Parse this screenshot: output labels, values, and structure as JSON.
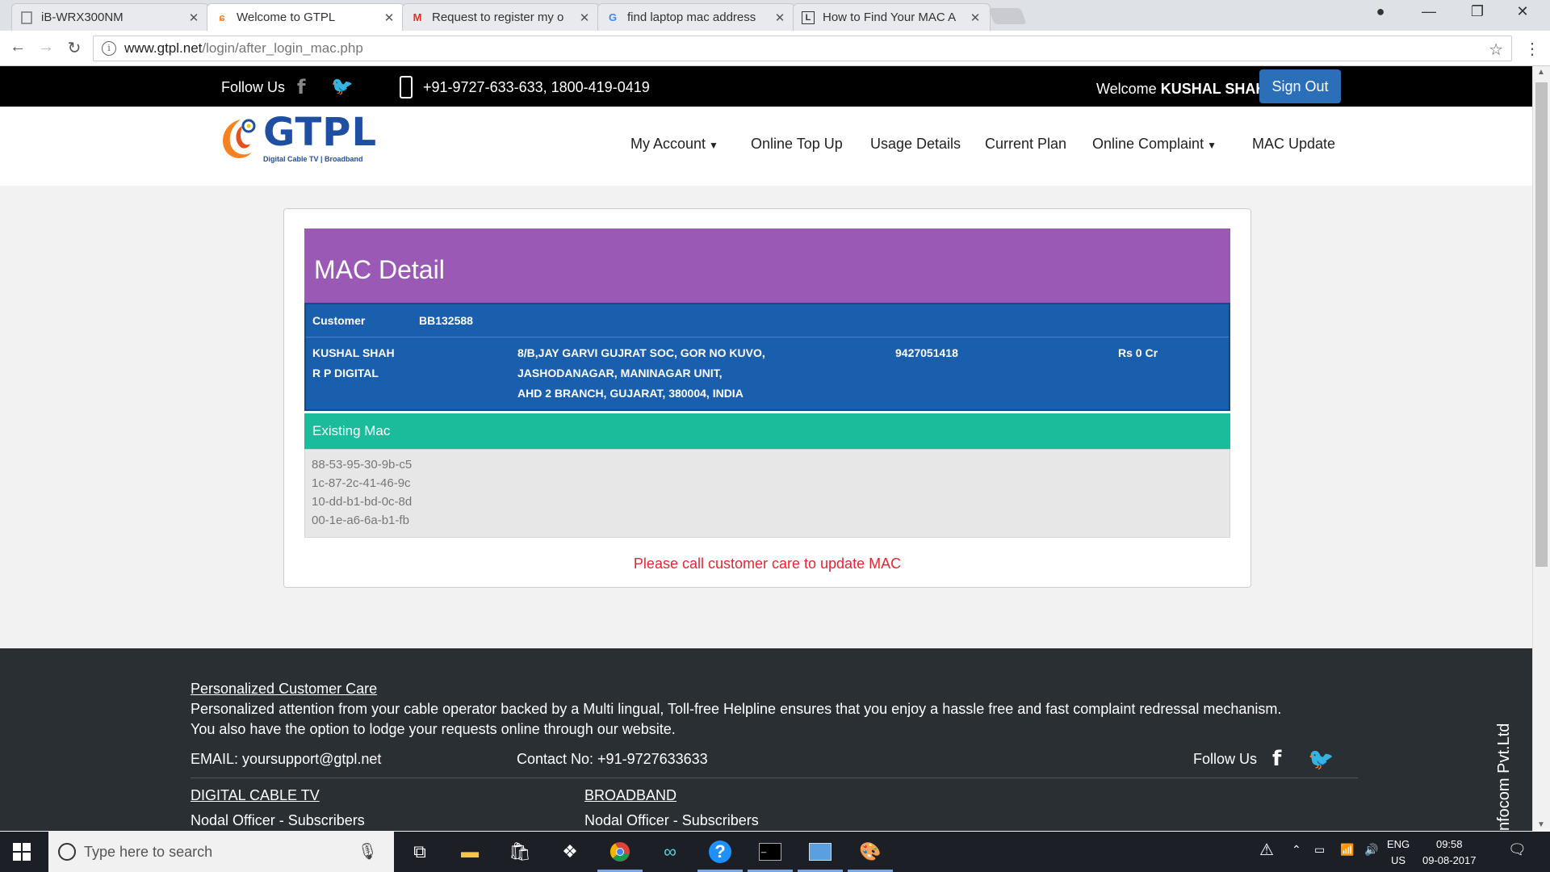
{
  "browser": {
    "tabs": [
      {
        "title": "iB-WRX300NM",
        "favicon": "page-icon"
      },
      {
        "title": "Welcome to GTPL",
        "favicon": "gtpl-icon"
      },
      {
        "title": "Request to register my o",
        "favicon": "gmail-icon"
      },
      {
        "title": "find laptop mac address",
        "favicon": "google-icon"
      },
      {
        "title": "How to Find Your MAC A",
        "favicon": "l-icon"
      }
    ],
    "url_host": "www.gtpl.net",
    "url_path": "/login/after_login_mac.php"
  },
  "topbar": {
    "follow_label": "Follow Us",
    "phones": "+91-9727-633-633, 1800-419-0419",
    "welcome_label": "Welcome",
    "user_name": "KUSHAL SHAH",
    "signout_label": "Sign Out"
  },
  "logo": {
    "name": "GTPL",
    "tagline": "Digital Cable TV | Broadband"
  },
  "nav": {
    "my_account": "My Account",
    "online_top_up": "Online Top Up",
    "usage_details": "Usage Details",
    "current_plan": "Current Plan",
    "online_complaint": "Online Complaint",
    "mac_update": "MAC Update"
  },
  "mac_detail": {
    "title": "MAC Detail",
    "customer_label": "Customer",
    "customer_id": "BB132588",
    "name": "KUSHAL SHAH",
    "operator": "R P DIGITAL",
    "address_line1": "8/B,JAY GARVI GUJRAT SOC, GOR NO KUVO,",
    "address_line2": "JASHODANAGAR, MANINAGAR UNIT,",
    "address_line3": "AHD 2 BRANCH, GUJARAT, 380004, INDIA",
    "phone": "9427051418",
    "balance": "Rs 0 Cr",
    "existing_mac_label": "Existing Mac",
    "macs": [
      "88-53-95-30-9b-c5",
      "1c-87-2c-41-46-9c",
      "10-dd-b1-bd-0c-8d",
      "00-1e-a6-6a-b1-fb"
    ],
    "note": "Please call customer care to update MAC"
  },
  "footer": {
    "care_title": "Personalized Customer Care",
    "care_line1": "Personalized attention from your cable operator backed by a Multi lingual, Toll-free Helpline ensures that you enjoy a hassle free and fast complaint redressal mechanism.",
    "care_line2": "You also have the option to lodge your requests online through our website.",
    "email": "EMAIL: yoursupport@gtpl.net",
    "contact": "Contact No: +91-9727633633",
    "follow_label": "Follow Us",
    "digital_cable": "DIGITAL CABLE TV",
    "broadband": "BROADBAND",
    "nodal1": "Nodal Officer - Subscribers",
    "nodal2": "Nodal Officer - Subscribers",
    "vertical": "nfocom Pvt.Ltd"
  },
  "taskbar": {
    "search_placeholder": "Type here to search",
    "lang_top": "ENG",
    "lang_bottom": "US",
    "time": "09:58",
    "date": "09-08-2017"
  },
  "colors": {
    "mac_banner": "#9b59b6",
    "customer_box": "#1a5fae",
    "existing_header": "#1abc9c",
    "note_red": "#e0282e",
    "signout_blue": "#2a6fb8"
  }
}
